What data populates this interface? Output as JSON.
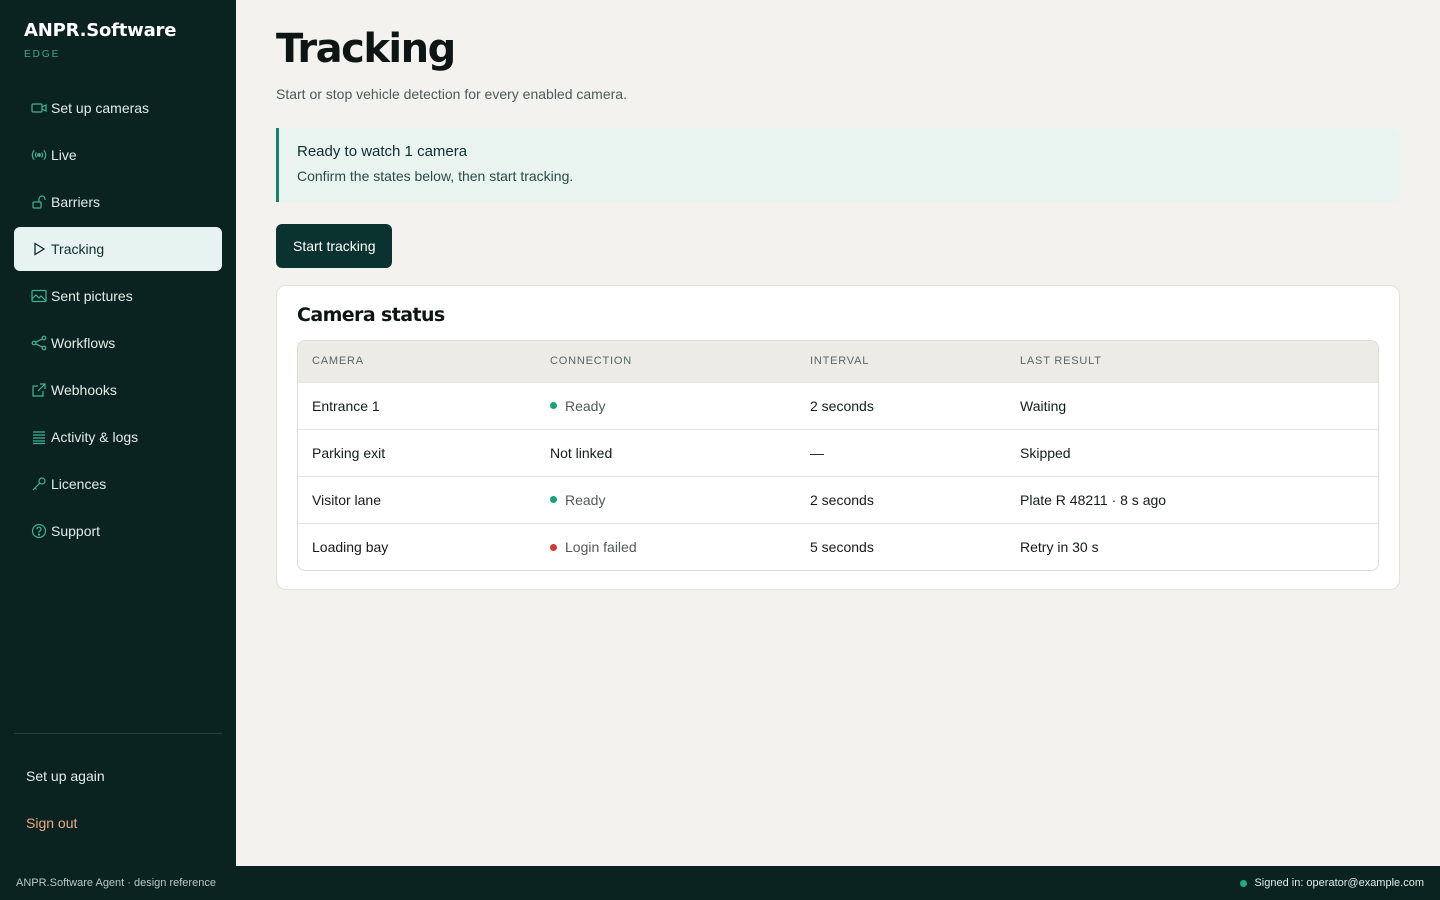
{
  "brand": {
    "name": "ANPR.Software",
    "sub": "EDGE"
  },
  "sidebar": {
    "items": [
      {
        "label": "Set up cameras",
        "icon": "camera-icon"
      },
      {
        "label": "Live",
        "icon": "broadcast-icon"
      },
      {
        "label": "Barriers",
        "icon": "unlock-icon"
      },
      {
        "label": "Tracking",
        "icon": "play-icon",
        "active": true
      },
      {
        "label": "Sent pictures",
        "icon": "image-icon"
      },
      {
        "label": "Workflows",
        "icon": "share-icon"
      },
      {
        "label": "Webhooks",
        "icon": "external-link-icon"
      },
      {
        "label": "Activity & logs",
        "icon": "list-icon"
      },
      {
        "label": "Licences",
        "icon": "key-icon"
      },
      {
        "label": "Support",
        "icon": "help-icon"
      }
    ],
    "setup_again": "Set up again",
    "sign_out": "Sign out"
  },
  "page": {
    "title": "Tracking",
    "subtitle": "Start or stop vehicle detection for every enabled camera."
  },
  "banner": {
    "title": "Ready to watch 1 camera",
    "body": "Confirm the states below, then start tracking."
  },
  "actions": {
    "start_label": "Start tracking"
  },
  "camera_status": {
    "title": "Camera status",
    "columns": [
      "CAMERA",
      "CONNECTION",
      "INTERVAL",
      "LAST RESULT"
    ],
    "rows": [
      {
        "camera": "Entrance 1",
        "connection": "Ready",
        "status": "ok",
        "interval": "2 seconds",
        "last_result": "Waiting"
      },
      {
        "camera": "Parking exit",
        "connection": "Not linked",
        "status": "none",
        "interval": "—",
        "last_result": "Skipped"
      },
      {
        "camera": "Visitor lane",
        "connection": "Ready",
        "status": "ok",
        "interval": "2 seconds",
        "last_result": "Plate R 48211 · 8 s ago"
      },
      {
        "camera": "Loading bay",
        "connection": "Login failed",
        "status": "error",
        "interval": "5 seconds",
        "last_result": "Retry in 30 s"
      }
    ]
  },
  "colors": {
    "status_ok": "#14a37a",
    "status_error": "#d13b2e",
    "accent": "#0a3330"
  },
  "footer": {
    "left": "ANPR.Software Agent · design reference",
    "right": "Signed in: operator@example.com"
  }
}
